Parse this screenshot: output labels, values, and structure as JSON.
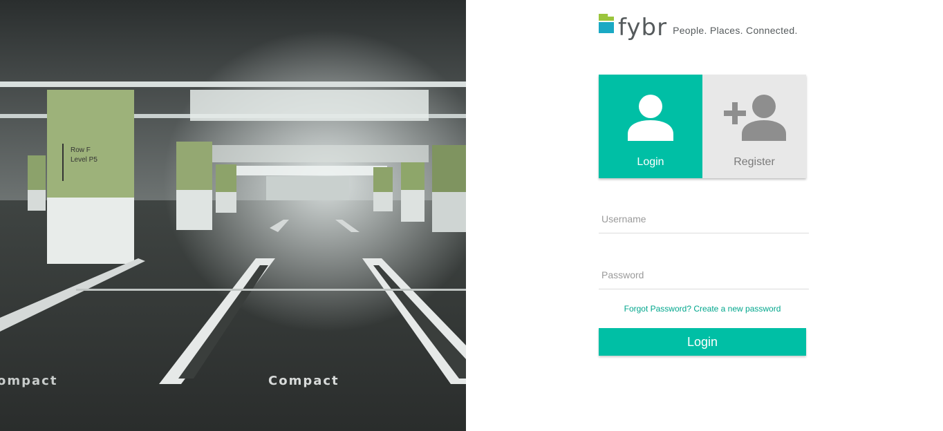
{
  "hero": {
    "sign_row": "Row F",
    "sign_level": "Level P5",
    "floor_text_left": "ompact",
    "floor_text_center": "Compact"
  },
  "brand": {
    "logo_text": "fybr",
    "tagline": "People. Places. Connected.",
    "colors": {
      "accent": "#00bfa5",
      "logo_green": "#9bc53d",
      "logo_blue": "#1aa9c4",
      "tab_inactive": "#e8e8e8"
    }
  },
  "tabs": [
    {
      "label": "Login",
      "icon": "user-icon",
      "active": true
    },
    {
      "label": "Register",
      "icon": "add-user-icon",
      "active": false
    }
  ],
  "form": {
    "username_placeholder": "Username",
    "username_value": "",
    "password_placeholder": "Password",
    "password_value": "",
    "forgot_text": "Forgot Password? Create a new password",
    "submit_label": "Login"
  }
}
